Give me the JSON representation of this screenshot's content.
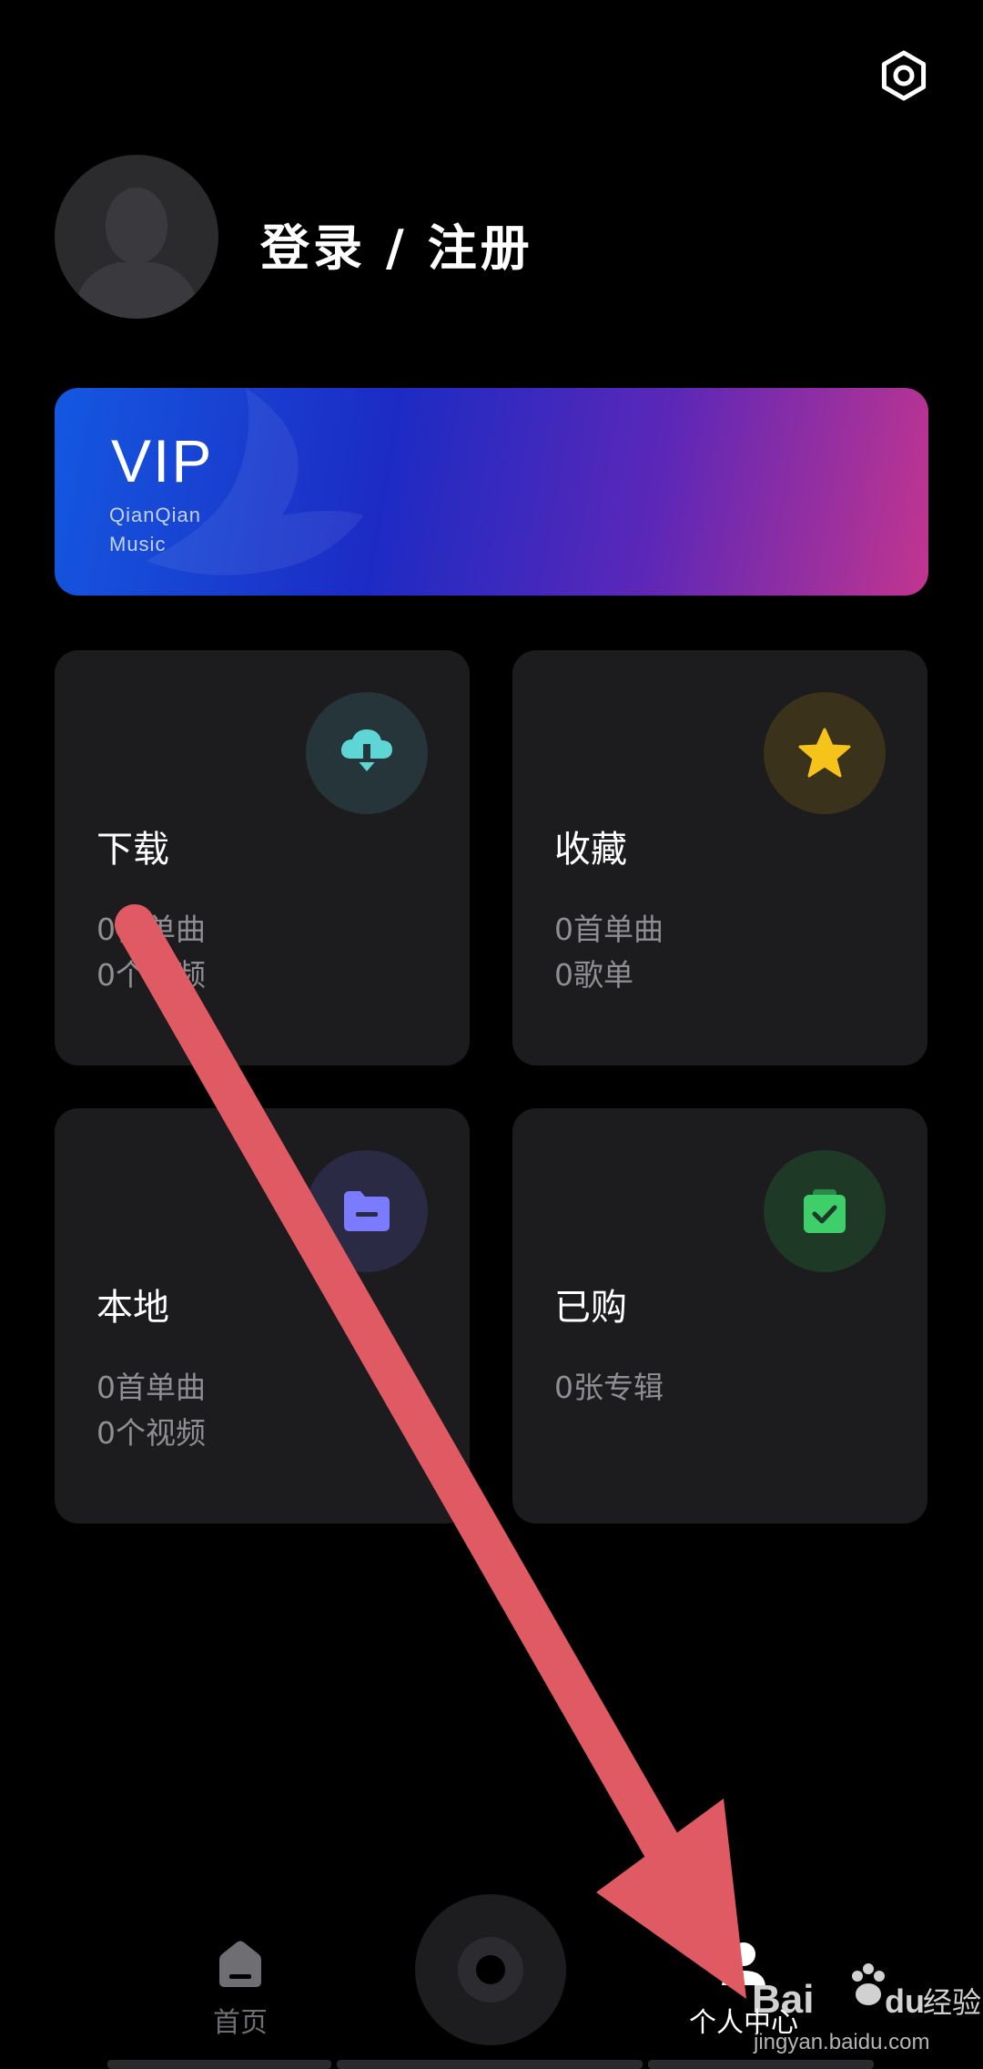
{
  "header": {
    "login_text": "登录",
    "separator": "/",
    "register_text": "注册"
  },
  "vip": {
    "title": "VIP",
    "subtitle_line1": "QianQian",
    "subtitle_line2": "Music"
  },
  "cards": [
    {
      "title": "下载",
      "stat1": "0首单曲",
      "stat2": "0个视频",
      "icon": "cloud-download-icon",
      "icon_color": "#5fd6d6"
    },
    {
      "title": "收藏",
      "stat1": "0首单曲",
      "stat2": "0歌单",
      "icon": "star-icon",
      "icon_color": "#f6c31a"
    },
    {
      "title": "本地",
      "stat1": "0首单曲",
      "stat2": "0个视频",
      "icon": "folder-icon",
      "icon_color": "#7b7bff"
    },
    {
      "title": "已购",
      "stat1": "0张专辑",
      "icon": "shopping-bag-check-icon",
      "icon_color": "#3fcf6a"
    }
  ],
  "nav": {
    "home_label": "首页",
    "profile_label": "个人中心"
  },
  "watermark": {
    "brand": "Bai",
    "brand_suffix": "du",
    "product": "经验",
    "url": "jingyan.baidu.com"
  },
  "colors": {
    "background": "#000000",
    "card_background": "#1c1c1f",
    "annotation_arrow": "#e05a63"
  }
}
